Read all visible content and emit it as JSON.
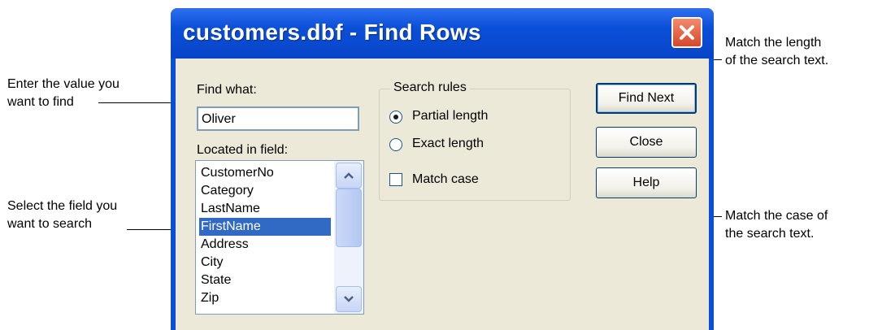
{
  "dialog": {
    "title": "customers.dbf - Find Rows",
    "find_what_label": "Find what:",
    "find_what_value": "Oliver",
    "located_label": "Located in field:",
    "fields": [
      "CustomerNo",
      "Category",
      "LastName",
      "FirstName",
      "Address",
      "City",
      "State",
      "Zip"
    ],
    "selected_field": "FirstName",
    "search_rules_label": "Search rules",
    "partial_length": "Partial length",
    "exact_length": "Exact length",
    "match_case": "Match case",
    "selected_rule": "Partial length",
    "match_case_checked": false,
    "buttons": {
      "find_next": "Find Next",
      "close": "Close",
      "help": "Help"
    }
  },
  "annotations": {
    "enter_value": [
      "Enter the value you",
      "want to find"
    ],
    "select_field": [
      "Select the field you",
      "want to search"
    ],
    "match_length": [
      "Match the length",
      "of the search text."
    ],
    "match_case": [
      "Match the case of",
      "the search text."
    ]
  },
  "colors": {
    "titlebar": "#0a4fd8",
    "dialog_bg": "#ece9d8",
    "selection": "#316ac5",
    "close_button": "#d8472a"
  }
}
